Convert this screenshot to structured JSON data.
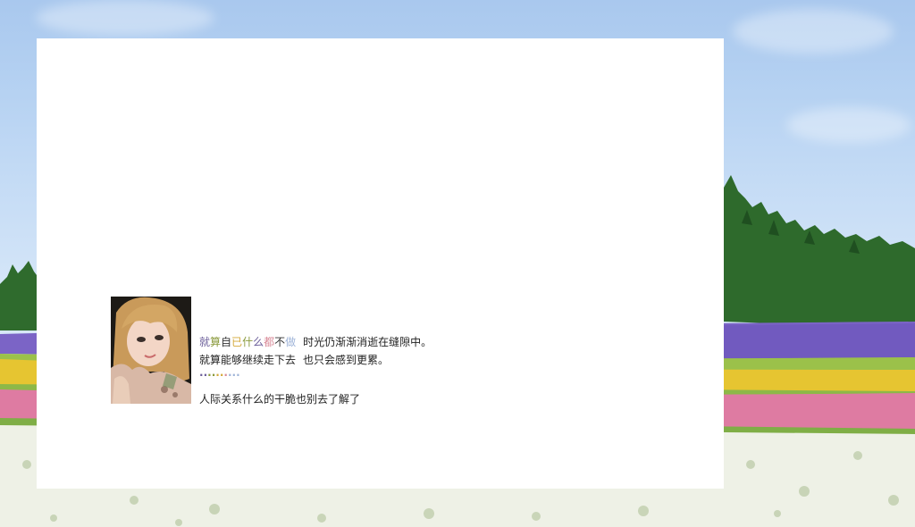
{
  "post": {
    "line1_colored": [
      {
        "text": "就",
        "color": "#6c5f9a"
      },
      {
        "text": "算",
        "color": "#8a9a3c"
      },
      {
        "text": "自",
        "color": "#333333"
      },
      {
        "text": "已",
        "color": "#d4a93a"
      },
      {
        "text": "什",
        "color": "#8a9a3c"
      },
      {
        "text": "么",
        "color": "#6c5f9a"
      },
      {
        "text": "都",
        "color": "#d98a98"
      },
      {
        "text": "不",
        "color": "#333333"
      },
      {
        "text": "做",
        "color": "#9fb4d8"
      }
    ],
    "line1_rest": "时光仍渐渐消逝在缝隙中。",
    "line2_part1": "就算能够继续走下去",
    "line2_part2": "也只会感到更累。",
    "dots": [
      {
        "text": "·",
        "color": "#6c5f9a"
      },
      {
        "text": "·",
        "color": "#6c5f9a"
      },
      {
        "text": "·",
        "color": "#8a9a3c"
      },
      {
        "text": "·",
        "color": "#8a9a3c"
      },
      {
        "text": "·",
        "color": "#d4a93a"
      },
      {
        "text": "·",
        "color": "#d4a93a"
      },
      {
        "text": "·",
        "color": "#d98a98"
      },
      {
        "text": "·",
        "color": "#9fb4d8"
      },
      {
        "text": "·",
        "color": "#9fb4d8"
      },
      {
        "text": "·",
        "color": "#9fb4d8"
      }
    ],
    "line3": "人际关系什么的干脆也别去了解了"
  },
  "avatar": {
    "icon": "girl-portrait-photo"
  },
  "colors": {
    "panel_bg": "#ffffff",
    "sky": "#b6d2f2",
    "lavender": "#7a63c4",
    "yellow_flowers": "#e8c530",
    "pink_flowers": "#e07ca4",
    "white_flowers": "#f2f4ee",
    "trees": "#2e6a2c"
  }
}
